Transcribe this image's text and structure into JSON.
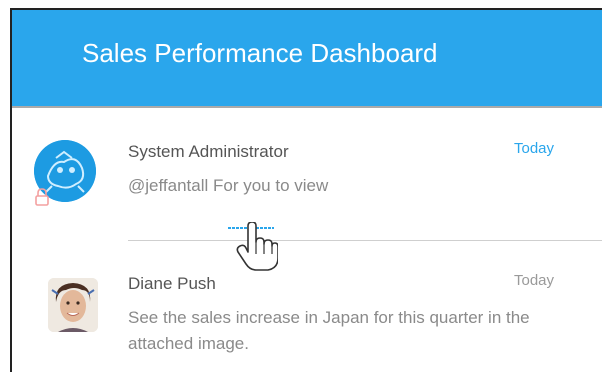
{
  "header": {
    "title": "Sales Performance Dashboard",
    "bg_color": "#2aa6ec"
  },
  "comments": [
    {
      "author": "System Administrator",
      "time": "Today",
      "message": "@jeffantall For you to view",
      "avatar": "robot-avatar",
      "lock_icon": "lock-icon"
    },
    {
      "author": "Diane Push",
      "time": "Today",
      "message_line1": "See the sales increase in Japan for this quarter in the",
      "message_line2": "attached image.",
      "avatar": "user-photo-avatar"
    }
  ],
  "cursor": "hand-pointer-icon"
}
